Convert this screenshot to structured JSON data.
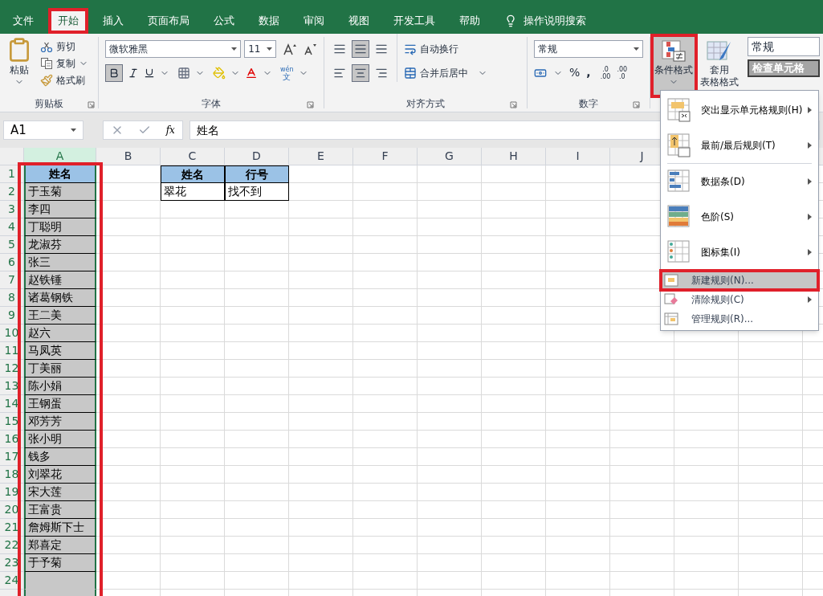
{
  "tabs": [
    {
      "label": "文件",
      "selected": false,
      "highlighted": false
    },
    {
      "label": "开始",
      "selected": true,
      "highlighted": true
    },
    {
      "label": "插入",
      "selected": false,
      "highlighted": false
    },
    {
      "label": "页面布局",
      "selected": false,
      "highlighted": false
    },
    {
      "label": "公式",
      "selected": false,
      "highlighted": false
    },
    {
      "label": "数据",
      "selected": false,
      "highlighted": false
    },
    {
      "label": "审阅",
      "selected": false,
      "highlighted": false
    },
    {
      "label": "视图",
      "selected": false,
      "highlighted": false
    },
    {
      "label": "开发工具",
      "selected": false,
      "highlighted": false
    },
    {
      "label": "帮助",
      "selected": false,
      "highlighted": false
    }
  ],
  "tell_me": "操作说明搜索",
  "ribbon": {
    "clipboard": {
      "paste": "粘贴",
      "cut": "剪切",
      "copy": "复制",
      "format_painter": "格式刷",
      "group": "剪贴板"
    },
    "font": {
      "font_name": "微软雅黑",
      "font_size": "11",
      "phonetic_top": "wén",
      "phonetic_bottom": "文",
      "group": "字体"
    },
    "alignment": {
      "wrap": "自动换行",
      "merge": "合并后居中",
      "group": "对齐方式"
    },
    "number": {
      "format": "常规",
      "percent": "%",
      "comma": ",",
      "decimal_up": [
        ".0",
        ".00"
      ],
      "decimal_down": [
        ".00",
        ".0"
      ],
      "group": "数字"
    },
    "styles": {
      "conditional": {
        "label": "条件格式",
        "highlighted": true
      },
      "table_format": [
        "套用",
        "表格格式"
      ],
      "style_normal": "常规",
      "style_check": "检查单元格"
    }
  },
  "formula_bar": {
    "name_box": "A1",
    "fx": "fx",
    "content": "姓名"
  },
  "sheet": {
    "columns": [
      "A",
      "B",
      "C",
      "D",
      "E",
      "F",
      "G",
      "H",
      "I",
      "J"
    ],
    "row_numbers": [
      "1",
      "2",
      "3",
      "4",
      "5",
      "6",
      "7",
      "8",
      "9",
      "10",
      "11",
      "12",
      "13",
      "14",
      "15",
      "16",
      "17",
      "18",
      "19",
      "20",
      "21",
      "22",
      "23",
      "24"
    ],
    "column_a": {
      "highlighted": true,
      "cells": [
        "姓名",
        "于玉菊",
        "李四",
        "丁聪明",
        "龙淑芬",
        "张三",
        "赵铁锤",
        "诸葛钢铁",
        "王二美",
        "赵六",
        "马凤英",
        "丁美丽",
        "陈小娟",
        "王钢蛋",
        "邓芳芳",
        "张小明",
        "钱多",
        "刘翠花",
        "宋大莲",
        "王富贵",
        "詹姆斯下士",
        "郑喜定",
        "于予菊"
      ]
    },
    "lookup_table": {
      "headers": [
        "姓名",
        "行号"
      ],
      "row": [
        "翠花",
        "找不到"
      ]
    }
  },
  "menu": [
    {
      "label": "突出显示单元格规则(H)",
      "kind": "large",
      "submenu": true,
      "selected": false,
      "highlighted": false
    },
    {
      "label": "最前/最后规则(T)",
      "kind": "large",
      "submenu": true,
      "selected": false,
      "highlighted": false
    },
    {
      "label": "数据条(D)",
      "kind": "large",
      "submenu": true,
      "selected": false,
      "highlighted": false
    },
    {
      "label": "色阶(S)",
      "kind": "large",
      "submenu": true,
      "selected": false,
      "highlighted": false
    },
    {
      "label": "图标集(I)",
      "kind": "large",
      "submenu": true,
      "selected": false,
      "highlighted": false
    },
    {
      "label": "新建规则(N)...",
      "kind": "small",
      "submenu": false,
      "selected": true,
      "highlighted": true
    },
    {
      "label": "清除规则(C)",
      "kind": "small",
      "submenu": true,
      "selected": false,
      "highlighted": false
    },
    {
      "label": "管理规则(R)...",
      "kind": "small",
      "submenu": false,
      "selected": false,
      "highlighted": false
    }
  ]
}
